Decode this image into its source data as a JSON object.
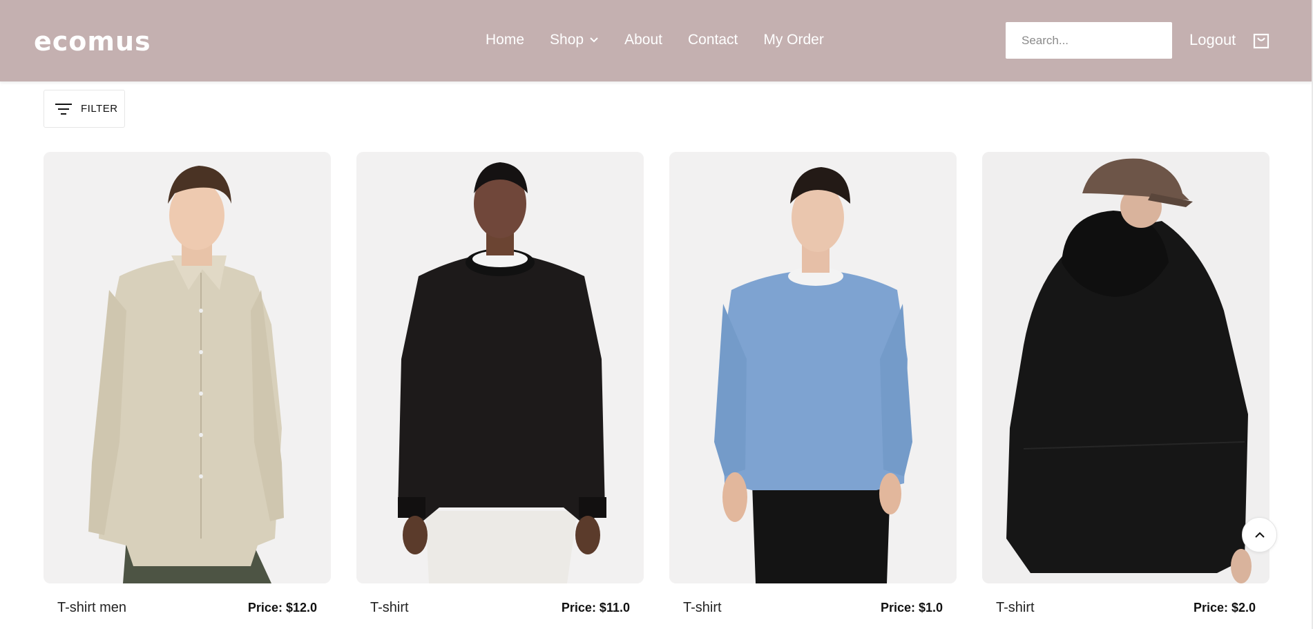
{
  "header": {
    "logo": "ecomus",
    "nav": [
      {
        "label": "Home"
      },
      {
        "label": "Shop"
      },
      {
        "label": "About"
      },
      {
        "label": "Contact"
      },
      {
        "label": "My Order"
      }
    ],
    "search_placeholder": "Search...",
    "logout_label": "Logout",
    "cart_icon": "shopping-bag-icon",
    "background_color": "#c4b0b0"
  },
  "filter": {
    "label": "FILTER",
    "icon": "filter-lines-icon"
  },
  "products": [
    {
      "name": "T-shirt men",
      "price": "Price: $12.0",
      "image": "man-beige-shirt"
    },
    {
      "name": "T-shirt",
      "price": "Price: $11.0",
      "image": "man-black-sweatshirt"
    },
    {
      "name": "T-shirt",
      "price": "Price: $1.0",
      "image": "man-blue-sweater"
    },
    {
      "name": "T-shirt",
      "price": "Price: $2.0",
      "image": "man-black-hooded-jacket-back"
    }
  ],
  "scroll_top_icon": "chevron-up-icon"
}
